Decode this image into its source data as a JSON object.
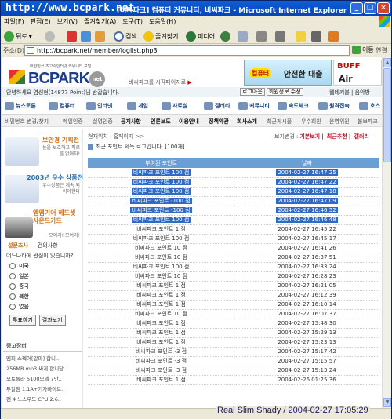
{
  "window": {
    "watermark": "http://www.bcpark.net",
    "title": "[비씨파크] 컴퓨터 커뮤니티, 비씨파크 - Microsoft Internet Explorer",
    "controls": [
      "_",
      "□",
      "×"
    ]
  },
  "menu": [
    "파일(F)",
    "편집(E)",
    "보기(V)",
    "즐겨찾기(A)",
    "도구(T)",
    "도움말(H)"
  ],
  "toolbar": {
    "back": "뒤로",
    "search": "검색",
    "favorites": "즐겨찾기",
    "media": "미디어"
  },
  "address": {
    "label": "주소(D)",
    "url": "http://bcpark.net/member/loglist.php3",
    "go": "이동",
    "links": "연결"
  },
  "site": {
    "logo_sub": "대한민국 초고속인터넷 커뮤니티 포털",
    "logo_name": "BCPARK",
    "logo_net": "net",
    "start_page": "비씨파크를 시작페이지로",
    "start_arrow": "▶",
    "ad1_badge": "컴퓨터",
    "ad1_text": "안전한 대출",
    "ad2_a": "BUFF",
    "ad2_b": "Air"
  },
  "loginbar": {
    "welcome": "안녕하세요 염성현(14877 Point)님 반갑습니다.",
    "logout": "로그아웃",
    "edit": "회원정보 수정",
    "right": "웹데키블 | 음악방"
  },
  "categories": [
    "뉴스토론",
    "컴퓨터",
    "인터넷",
    "게임",
    "자료실",
    "갤러리",
    "커뮤니티",
    "속도체크",
    "원격접속",
    "호스"
  ],
  "subnav": [
    "비밀번호 변경/찾기",
    "메일인증",
    "실명인증",
    "공지사항",
    "언론보도",
    "이용안내",
    "정책약관",
    "회사소개",
    "최근게시물",
    "우수회원",
    "운영위원",
    "불보파크"
  ],
  "left": {
    "promo1_title": "보안경 기획전",
    "promo1_desc": "눈을 보호하고 피로를 없애자!",
    "promo2_title": "2003년 우수 상품전",
    "promo2_desc": "우수상품은 계속 되어야한다",
    "promo3_title": "엠엠기어 헤드셋 사운드카드",
    "promo3_desc": "모여라! 모여라!",
    "poll_tab1": "설문조사",
    "poll_tab2": "건의사항",
    "poll_question": "어느나라에 관심이 있습니까?",
    "poll_options": [
      "미국",
      "일본",
      "중국",
      "북한",
      "없음"
    ],
    "poll_vote": "투표하기",
    "poll_result": "결과보기",
    "market_header": "중고장터",
    "market_items": [
      "멤피 스펙어[알파] 합니..",
      "256MB mp3 싸게 합니당..",
      "모토롤라 5100모델 7만..",
      "투알엠 1.1A+기가바이트..",
      "팬 4 노스우드 CPU 2.6.."
    ]
  },
  "main": {
    "crumb": "현재위치 : 홈페이지 >>",
    "logtabs_label": "보기변경 :",
    "logtabs": [
      "기본보기",
      "최근추천",
      "갤러리"
    ],
    "intro": "최근 포인트 획득 로그입니다. [100개]",
    "columns": [
      "부여된 포인트",
      "날짜"
    ],
    "rows": [
      {
        "point": "비씨파크 포인트 100 점",
        "date": "2004-02-27 16:47:25",
        "selected": true
      },
      {
        "point": "비씨파크 포인트 100 점",
        "date": "2004-02-27 16:47:22",
        "selected": true
      },
      {
        "point": "비씨파크 포인트 100 점",
        "date": "2004-02-27 16:47:18",
        "selected": true
      },
      {
        "point": "비씨파크 포인트 -100 점",
        "date": "2004-02-27 16:47:09",
        "selected": true
      },
      {
        "point": "비씨파크 포인트 -100 점",
        "date": "2004-02-27 16:46:52",
        "selected": true
      },
      {
        "point": "비씨파크 포인트 100 점",
        "date": "2004-02-27 16:46:48",
        "selected": true
      },
      {
        "point": "비씨파크 포인트 1 점",
        "date": "2004-02-27 16:45:22",
        "selected": false
      },
      {
        "point": "비씨파크 포인트 100 점",
        "date": "2004-02-27 16:45:17",
        "selected": false
      },
      {
        "point": "비씨파크 포인트 10 점",
        "date": "2004-02-27 16:41:26",
        "selected": false
      },
      {
        "point": "비씨파크 포인트 10 점",
        "date": "2004-02-27 16:37:51",
        "selected": false
      },
      {
        "point": "비씨파크 포인트 100 점",
        "date": "2004-02-27 16:33:24",
        "selected": false
      },
      {
        "point": "비씨파크 포인트 10 점",
        "date": "2004-02-27 16:28:23",
        "selected": false
      },
      {
        "point": "비씨파크 포인트 1 점",
        "date": "2004-02-27 16:21:05",
        "selected": false
      },
      {
        "point": "비씨파크 포인트 1 점",
        "date": "2004-02-27 16:12:39",
        "selected": false
      },
      {
        "point": "비씨파크 포인트 1 점",
        "date": "2004-02-27 16:10:14",
        "selected": false
      },
      {
        "point": "비씨파크 포인트 10 점",
        "date": "2004-02-27 16:07:37",
        "selected": false
      },
      {
        "point": "비씨파크 포인트 1 점",
        "date": "2004-02-27 15:48:30",
        "selected": false
      },
      {
        "point": "비씨파크 포인트 1 점",
        "date": "2004-02-27 15:29:13",
        "selected": false
      },
      {
        "point": "비씨파크 포인트 1 점",
        "date": "2004-02-27 15:23:13",
        "selected": false
      },
      {
        "point": "비씨파크 포인트 -3 점",
        "date": "2004-02-27 15:17:42",
        "selected": false
      },
      {
        "point": "비씨파크 포인트 -3 점",
        "date": "2004-02-27 15:15:57",
        "selected": false
      },
      {
        "point": "비씨파크 포인트 -3 점",
        "date": "2004-02-27 15:13:24",
        "selected": false
      },
      {
        "point": "비씨파크 포인트 1 점",
        "date": "2004-02-26 01:25:36",
        "selected": false
      }
    ]
  },
  "status": {
    "text": "",
    "signature": "Real Slim Shady / 2004-02-27 17:05:29"
  }
}
